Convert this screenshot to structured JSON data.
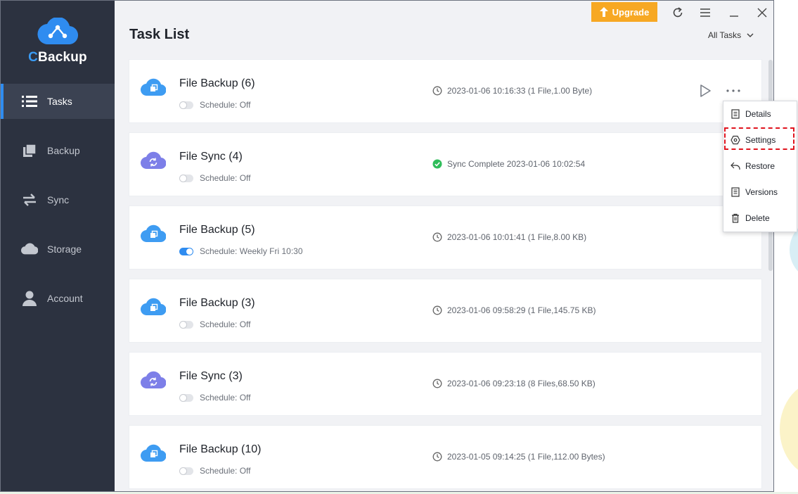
{
  "app": {
    "logo_text_c": "C",
    "logo_text_rest": "Backup"
  },
  "sidebar": {
    "items": [
      {
        "label": "Tasks",
        "icon": "list-icon",
        "active": true
      },
      {
        "label": "Backup",
        "icon": "backup-icon",
        "active": false
      },
      {
        "label": "Sync",
        "icon": "sync-arrows-icon",
        "active": false
      },
      {
        "label": "Storage",
        "icon": "cloud-icon",
        "active": false
      },
      {
        "label": "Account",
        "icon": "user-icon",
        "active": false
      }
    ]
  },
  "header": {
    "title": "Task List",
    "upgrade_label": "Upgrade",
    "filter_label": "All Tasks"
  },
  "tasks": [
    {
      "name": "File Backup (6)",
      "type": "backup",
      "schedule": "Schedule: Off",
      "schedule_on": false,
      "status": "2023-01-06 10:16:33 (1 File,1.00 Byte)",
      "status_icon": "clock-icon"
    },
    {
      "name": "File Sync (4)",
      "type": "sync",
      "schedule": "Schedule: Off",
      "schedule_on": false,
      "status": "Sync Complete 2023-01-06 10:02:54",
      "status_icon": "check-circle-icon"
    },
    {
      "name": "File Backup (5)",
      "type": "backup",
      "schedule": "Schedule: Weekly Fri 10:30",
      "schedule_on": true,
      "status": "2023-01-06 10:01:41 (1 File,8.00 KB)",
      "status_icon": "clock-icon"
    },
    {
      "name": "File Backup (3)",
      "type": "backup",
      "schedule": "Schedule: Off",
      "schedule_on": false,
      "status": "2023-01-06 09:58:29 (1 File,145.75 KB)",
      "status_icon": "clock-icon"
    },
    {
      "name": "File Sync (3)",
      "type": "sync",
      "schedule": "Schedule: Off",
      "schedule_on": false,
      "status": "2023-01-06 09:23:18 (8 Files,68.50 KB)",
      "status_icon": "clock-icon"
    },
    {
      "name": "File Backup (10)",
      "type": "backup",
      "schedule": "Schedule: Off",
      "schedule_on": false,
      "status": "2023-01-05 09:14:25 (1 File,112.00 Bytes)",
      "status_icon": "clock-icon"
    }
  ],
  "context_menu": {
    "items": [
      {
        "label": "Details",
        "icon": "details-icon"
      },
      {
        "label": "Settings",
        "icon": "settings-icon"
      },
      {
        "label": "Restore",
        "icon": "restore-icon"
      },
      {
        "label": "Versions",
        "icon": "versions-icon"
      },
      {
        "label": "Delete",
        "icon": "trash-icon"
      }
    ],
    "highlighted": "Settings"
  },
  "colors": {
    "sidebar_bg": "#2c3240",
    "accent": "#2f8cf0",
    "upgrade": "#f7a823",
    "success": "#2fbd5a",
    "highlight_border": "#e0141e"
  }
}
